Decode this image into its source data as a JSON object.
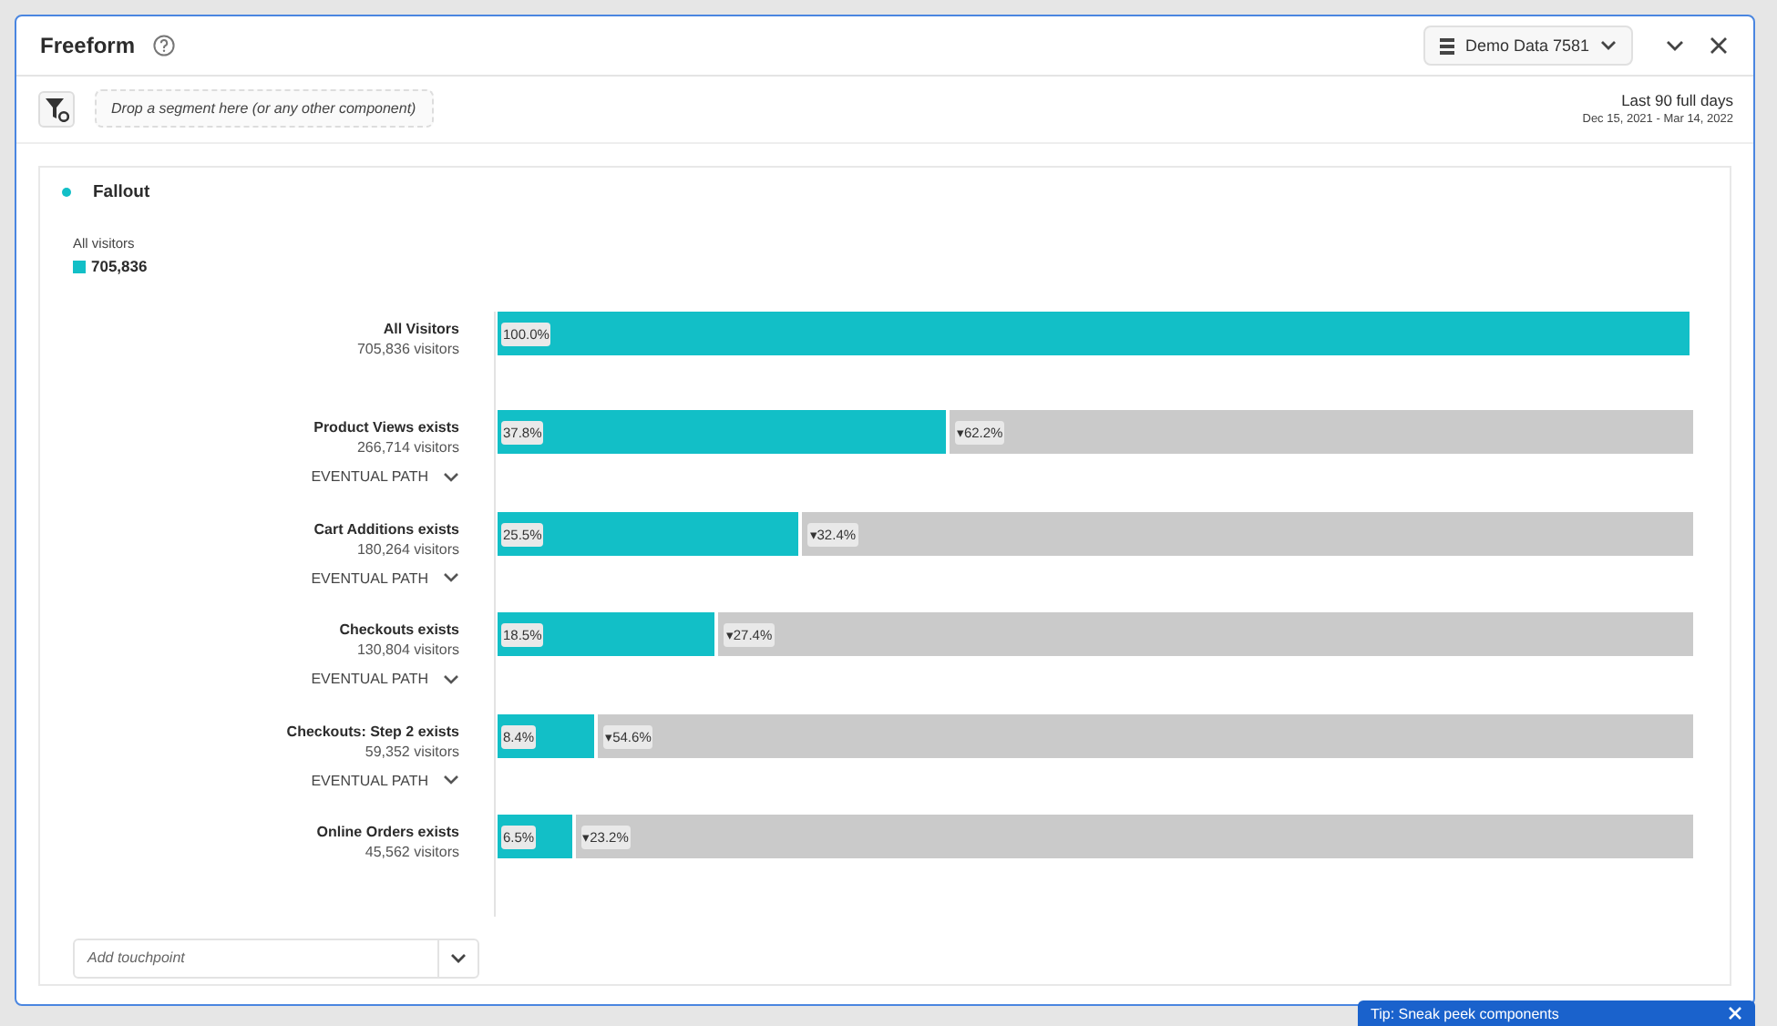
{
  "panel": {
    "title": "Freeform",
    "data_view": "Demo Data 7581",
    "segment_placeholder": "Drop a segment here (or any other component)",
    "date_range": "Last 90 full days",
    "date_detail": "Dec 15, 2021 - Mar 14, 2022"
  },
  "fallout": {
    "title": "Fallout",
    "legend_label": "All visitors",
    "legend_value": "705,836",
    "steps": [
      {
        "name": "All Visitors",
        "visitors": "705,836 visitors",
        "level": 1.0,
        "percent": "100.0%"
      },
      {
        "name": "Product Views exists",
        "visitors": "266,714 visitors",
        "level": 0.378,
        "percent": "37.8%",
        "drop": "▾62.2%",
        "path": "EVENTUAL PATH"
      },
      {
        "name": "Cart Additions exists",
        "visitors": "180,264 visitors",
        "level": 0.255,
        "percent": "25.5%",
        "drop": "▾32.4%",
        "path": "EVENTUAL PATH"
      },
      {
        "name": "Checkouts exists",
        "visitors": "130,804 visitors",
        "level": 0.185,
        "percent": "18.5%",
        "drop": "▾27.4%",
        "path": "EVENTUAL PATH"
      },
      {
        "name": "Checkouts: Step 2 exists",
        "visitors": "59,352 visitors",
        "level": 0.084,
        "percent": "8.4%",
        "drop": "▾54.6%",
        "path": "EVENTUAL PATH"
      },
      {
        "name": "Online Orders exists",
        "visitors": "45,562 visitors",
        "level": 0.065,
        "percent": "6.5%",
        "drop": "▾23.2%"
      }
    ],
    "touchpoint_placeholder": "Add touchpoint"
  },
  "toast": {
    "text": "Tip: Sneak peek components"
  }
}
